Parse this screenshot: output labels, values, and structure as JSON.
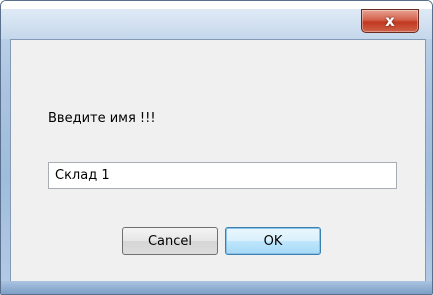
{
  "window": {
    "close_glyph": "x"
  },
  "dialog": {
    "prompt_label": "Введите имя !!!",
    "name_input_value": "Склад 1",
    "cancel_label": "Cancel",
    "ok_label": "OK"
  },
  "colors": {
    "frame": "#aac3e0",
    "client_bg": "#f0f0f0",
    "close_button": "#c0391f",
    "ok_button_border": "#3c7fb1"
  },
  "icons": {
    "close": "close-icon"
  }
}
